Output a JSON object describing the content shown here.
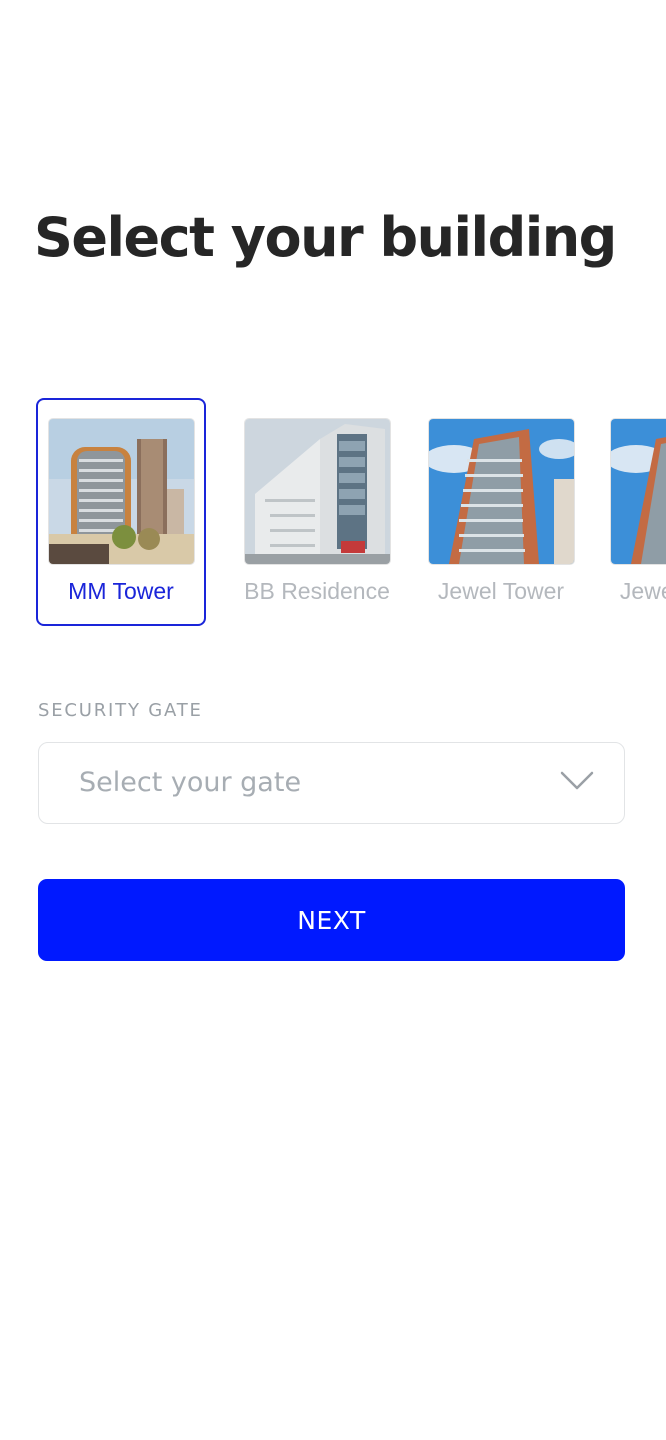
{
  "page": {
    "title": "Select your building"
  },
  "buildings": [
    {
      "name": "MM Tower",
      "selected": true
    },
    {
      "name": "BB Residence",
      "selected": false
    },
    {
      "name": "Jewel Tower",
      "selected": false
    },
    {
      "name": "Jewel Tower",
      "selected": false
    }
  ],
  "gate": {
    "label": "SECURITY GATE",
    "placeholder": "Select your gate",
    "icon": "chevron-down-icon"
  },
  "actions": {
    "next_label": "NEXT"
  },
  "colors": {
    "accent": "#0019ff",
    "selected_border": "#1a25d9",
    "muted_text": "#b4b8bd",
    "title_text": "#262626"
  }
}
